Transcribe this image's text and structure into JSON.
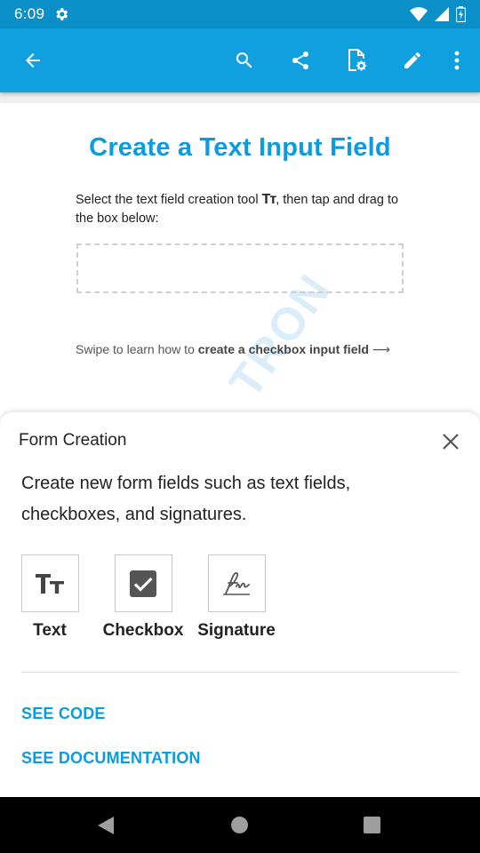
{
  "status_bar": {
    "time": "6:09",
    "icons": [
      "settings-icon",
      "wifi-icon",
      "signal-icon",
      "battery-icon"
    ],
    "background": "#0b8fc9"
  },
  "app_bar": {
    "background": "#10a0e0",
    "icons": [
      "back-arrow-icon",
      "search-icon",
      "share-icon",
      "file-settings-icon",
      "edit-pencil-icon",
      "overflow-menu-icon"
    ]
  },
  "document": {
    "title": "Create a Text Input Field",
    "instruction_before": "Select the text field creation tool",
    "tool_glyph": "Tт",
    "instruction_after": ", then tap and drag to the box below:",
    "swipe_prefix": "Swipe to learn how to ",
    "swipe_link": "create a checkbox input field",
    "swipe_arrow": "⟶",
    "watermark": "TRON",
    "accent": "#0b9be0"
  },
  "sheet": {
    "title": "Form Creation",
    "description": "Create new form fields such as text fields, checkboxes, and signatures.",
    "tools": [
      {
        "label": "Text",
        "icon": "text-field-icon"
      },
      {
        "label": "Checkbox",
        "icon": "checkbox-icon"
      },
      {
        "label": "Signature",
        "icon": "signature-icon"
      }
    ],
    "links": {
      "code": "SEE CODE",
      "documentation": "SEE DOCUMENTATION"
    }
  },
  "nav_bar": {
    "icons": [
      "nav-back-icon",
      "nav-home-icon",
      "nav-recents-icon"
    ]
  }
}
